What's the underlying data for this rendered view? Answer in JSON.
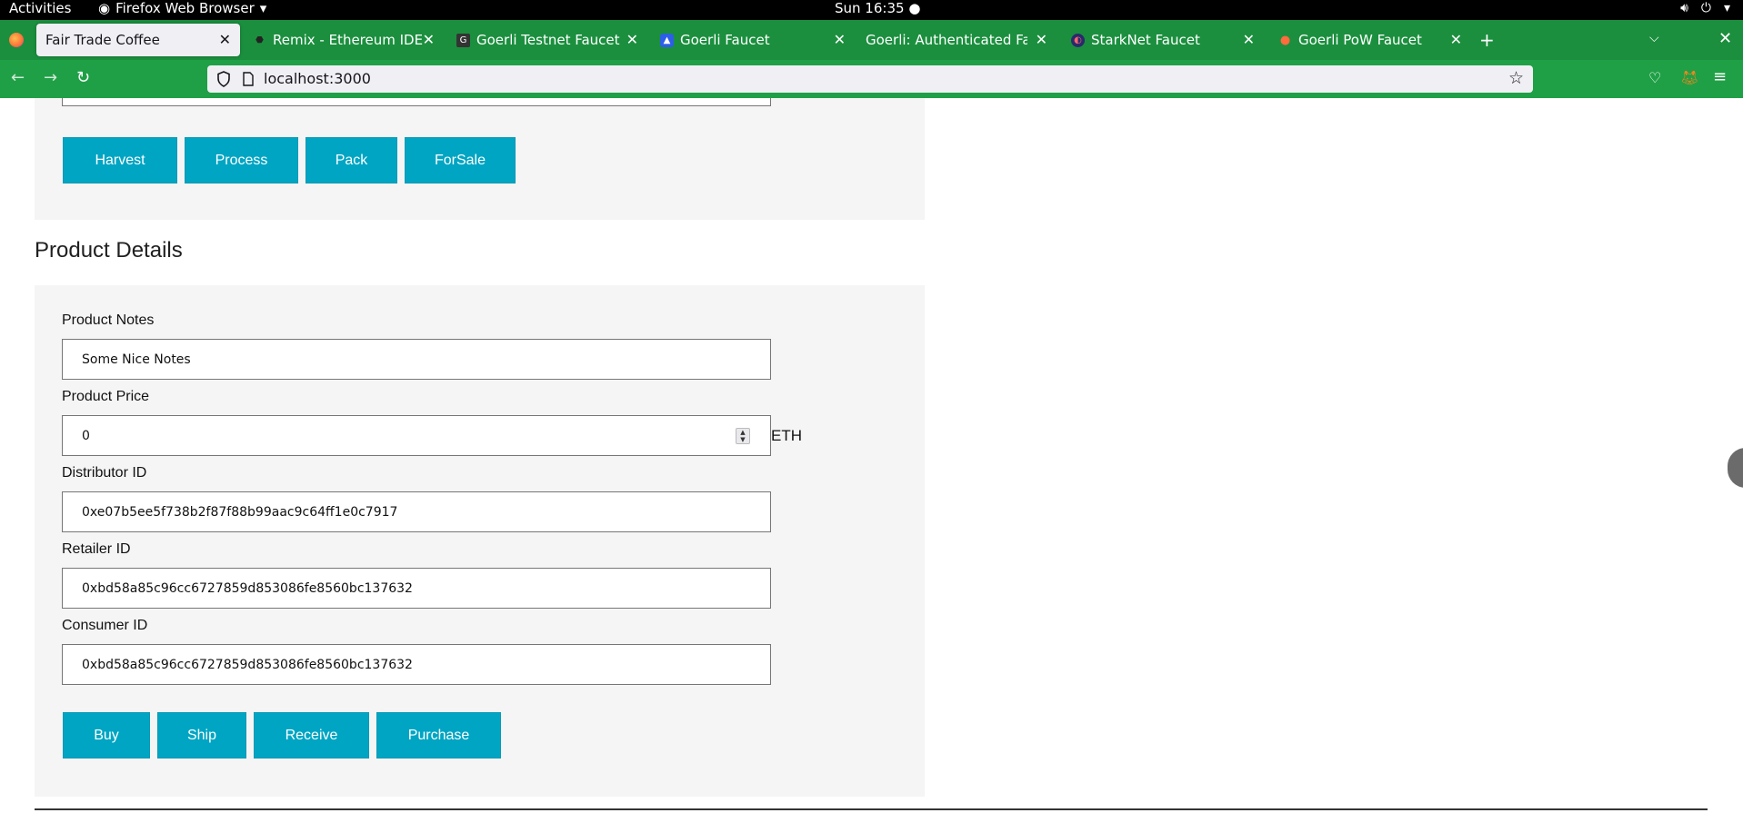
{
  "topbar": {
    "activities": "Activities",
    "app_name": "Firefox Web Browser",
    "clock": "Sun 16:35"
  },
  "tabs": [
    {
      "label": "Fair Trade Coffee",
      "icon": "blank-page-icon"
    },
    {
      "label": "Remix - Ethereum IDE",
      "icon": "remix-icon"
    },
    {
      "label": "Goerli Testnet Faucet",
      "icon": "faucet-icon"
    },
    {
      "label": "Goerli Faucet",
      "icon": "alchemy-icon"
    },
    {
      "label": "Goerli: Authenticated Faucet",
      "icon": "blank-page-icon"
    },
    {
      "label": "StarkNet Faucet",
      "icon": "starknet-icon"
    },
    {
      "label": "Goerli PoW Faucet",
      "icon": "drop-icon"
    }
  ],
  "navbar": {
    "url": "localhost:3000"
  },
  "colors": {
    "tabstrip": "#1b8f3e",
    "navbar": "#1fa046",
    "button": "#00a5c3",
    "panel": "#f5f5f5"
  },
  "top_actions": {
    "harvest": "Harvest",
    "process": "Process",
    "pack": "Pack",
    "forsale": "ForSale"
  },
  "product_details": {
    "title": "Product Details",
    "notes_label": "Product Notes",
    "notes_value": "Some Nice Notes",
    "price_label": "Product Price",
    "price_value": "0",
    "price_unit": "ETH",
    "distributor_label": "Distributor ID",
    "distributor_value": "0xe07b5ee5f738b2f87f88b99aac9c64ff1e0c7917",
    "retailer_label": "Retailer ID",
    "retailer_value": "0xbd58a85c96cc6727859d853086fe8560bc137632",
    "consumer_label": "Consumer ID",
    "consumer_value": "0xbd58a85c96cc6727859d853086fe8560bc137632"
  },
  "bottom_actions": {
    "buy": "Buy",
    "ship": "Ship",
    "receive": "Receive",
    "purchase": "Purchase"
  }
}
